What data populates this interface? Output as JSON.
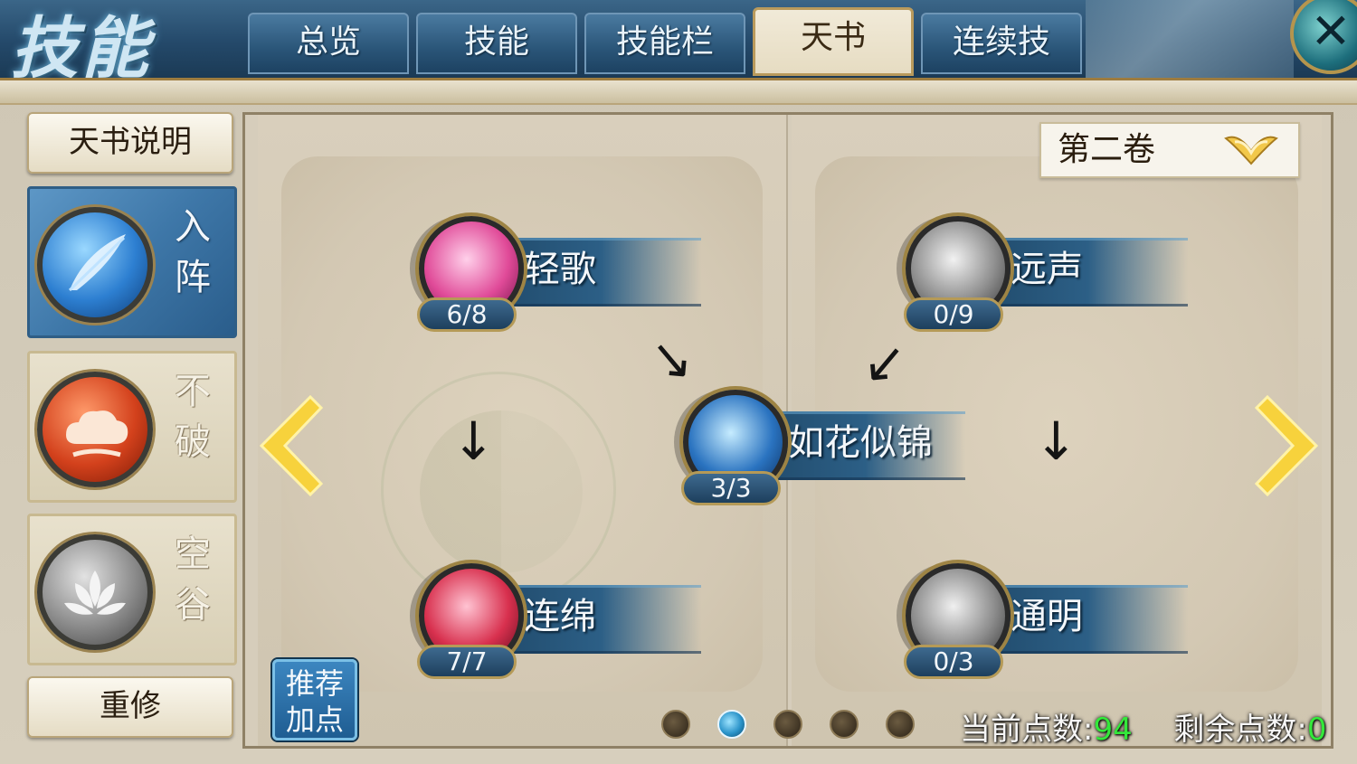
{
  "header": {
    "title": "技能",
    "tabs": [
      {
        "label": "总览",
        "active": false
      },
      {
        "label": "技能",
        "active": false
      },
      {
        "label": "技能栏",
        "active": false
      },
      {
        "label": "天书",
        "active": true
      },
      {
        "label": "连续技",
        "active": false
      }
    ],
    "close_icon": "close-x-icon"
  },
  "sidebar": {
    "top_button": "天书说明",
    "formations": [
      {
        "name": "入阵",
        "chars": [
          "入",
          "阵"
        ],
        "icon": "feather-icon",
        "active": true,
        "color": "#2d7fd1"
      },
      {
        "name": "不破",
        "chars": [
          "不",
          "破"
        ],
        "icon": "cloud-icon",
        "active": false,
        "color": "#d3411c"
      },
      {
        "name": "空谷",
        "chars": [
          "空",
          "谷"
        ],
        "icon": "lotus-icon",
        "active": false,
        "color": "#8a8a8a"
      }
    ],
    "bottom_button": "重修"
  },
  "book": {
    "volume_select": {
      "value": "第二卷"
    },
    "recommend_button": {
      "line1": "推荐",
      "line2": "加点"
    },
    "skills": [
      {
        "name": "轻歌",
        "level": "6/8",
        "icon": "pink-lotus-icon",
        "color": "#e04a98"
      },
      {
        "name": "远声",
        "level": "0/9",
        "icon": "grey-shield-icon",
        "color": "#8e8e8e"
      },
      {
        "name": "如花似锦",
        "level": "3/3",
        "icon": "blue-dragon-icon",
        "color": "#2a73c0"
      },
      {
        "name": "连绵",
        "level": "7/7",
        "icon": "red-blossom-icon",
        "color": "#d8304e"
      },
      {
        "name": "通明",
        "level": "0/3",
        "icon": "grey-sword-icon",
        "color": "#8b8b8b"
      }
    ],
    "pagination": {
      "count": 5,
      "active_index": 1
    },
    "points": {
      "current_label": "当前点数:",
      "current_value": "94",
      "remaining_label": "剩余点数:",
      "remaining_value": "0"
    }
  },
  "colors": {
    "accent_gold": "#b5954d",
    "points_green": "#33e83a",
    "tab_blue": "#2a5578"
  }
}
